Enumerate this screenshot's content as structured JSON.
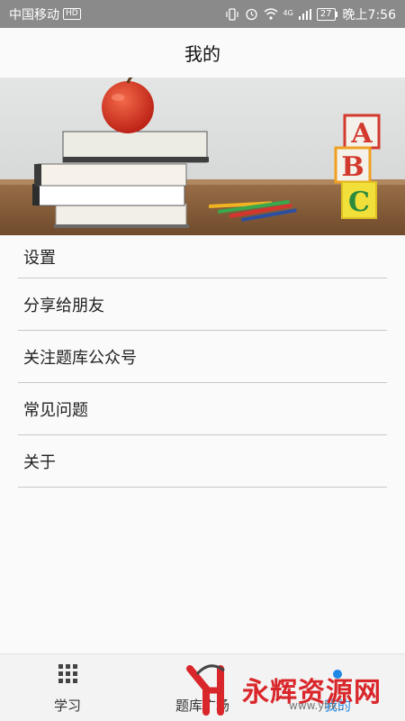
{
  "status_bar": {
    "carrier": "中国移动",
    "hd": "HD",
    "network": "4G",
    "battery": "27",
    "time": "晚上7:56"
  },
  "page": {
    "title": "我的"
  },
  "menu": {
    "items": [
      {
        "label": "设置"
      },
      {
        "label": "分享给朋友"
      },
      {
        "label": "关注题库公众号"
      },
      {
        "label": "常见问题"
      },
      {
        "label": "关于"
      }
    ]
  },
  "tabbar": {
    "tabs": [
      {
        "label": "学习",
        "icon": "grid-icon",
        "active": false
      },
      {
        "label": "题库广场",
        "icon": "",
        "active": false
      },
      {
        "label": "我的",
        "icon": "dot-icon",
        "active": true
      }
    ]
  },
  "watermark": {
    "text": "永辉资源网",
    "url": "www.yhk..."
  },
  "colors": {
    "accent": "#1e88e5",
    "status_bar": "#8a8a8a",
    "watermark": "#d9262a"
  }
}
